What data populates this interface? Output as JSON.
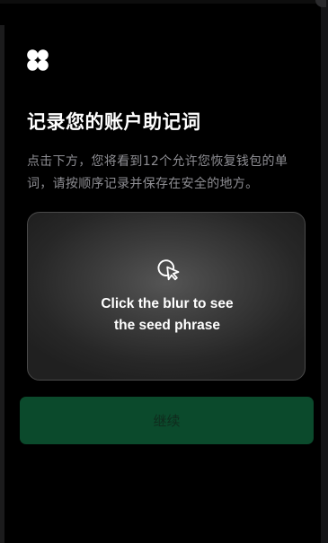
{
  "page": {
    "title": "记录您的账户助记词",
    "description": "点击下方，您将看到12个允许您恢复钱包的单词，请按顺序记录并保存在安全的地方。"
  },
  "blur_card": {
    "line1": "Click the blur to see",
    "line2": "the seed phrase"
  },
  "actions": {
    "continue_label": "继续"
  },
  "icons": {
    "logo": "four-circles-logo-icon",
    "cursor": "cursor-click-icon"
  },
  "colors": {
    "background": "#000000",
    "button_disabled": "#0b4a2c",
    "text_primary": "#ffffff",
    "text_secondary": "#8e8e93"
  }
}
